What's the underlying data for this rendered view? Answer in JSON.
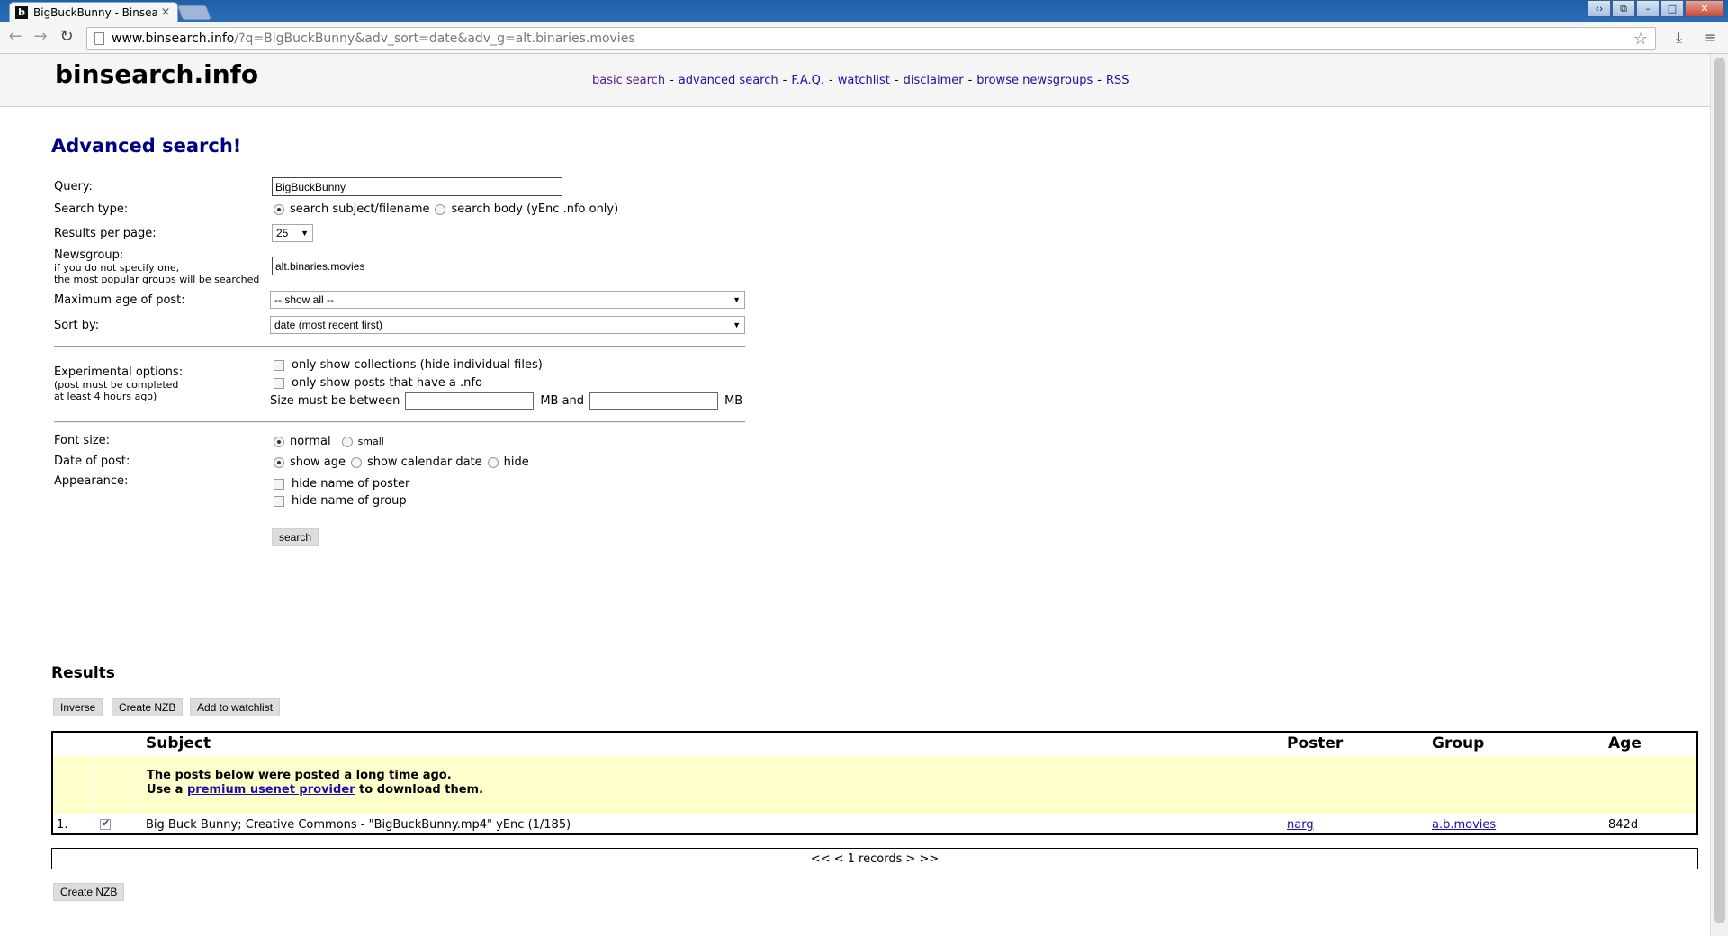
{
  "browser": {
    "tab_title": "BigBuckBunny - Binsearch",
    "favicon_letter": "b",
    "url_domain": "www.binsearch.info",
    "url_rest": "/?q=BigBuckBunny&adv_sort=date&adv_g=alt.binaries.movies"
  },
  "site": {
    "logo": "binsearch.info",
    "nav": [
      "basic search",
      "advanced search",
      "F.A.Q.",
      "watchlist",
      "disclaimer",
      "browse newsgroups",
      "RSS"
    ],
    "nav_separator": "-"
  },
  "form": {
    "title": "Advanced search!",
    "query_label": "Query:",
    "query_value": "BigBuckBunny",
    "search_type_label": "Search type:",
    "search_type_options": [
      "search subject/filename",
      "search body (yEnc .nfo only)"
    ],
    "results_per_page_label": "Results per page:",
    "results_per_page_value": "25",
    "newsgroup_label": "Newsgroup:",
    "newsgroup_hint_1": "if you do not specify one,",
    "newsgroup_hint_2": "the most popular groups will be searched",
    "newsgroup_value": "alt.binaries.movies",
    "max_age_label": "Maximum age of post:",
    "max_age_value": "-- show all --",
    "sort_label": "Sort by:",
    "sort_value": "date (most recent first)",
    "experimental_label": "Experimental options:",
    "experimental_hint_1": "(post must be completed",
    "experimental_hint_2": "at least 4 hours ago)",
    "opt_collections": "only show collections (hide individual files)",
    "opt_nfo": "only show posts that have a .nfo",
    "size_prefix": "Size must be between",
    "size_mid": "MB and",
    "size_suffix": "MB",
    "font_size_label": "Font size:",
    "font_size_options": [
      "normal",
      "small"
    ],
    "date_label": "Date of post:",
    "date_options": [
      "show age",
      "show calendar date",
      "hide"
    ],
    "appearance_label": "Appearance:",
    "opt_hide_poster": "hide name of poster",
    "opt_hide_group": "hide name of group",
    "search_button": "search"
  },
  "results": {
    "heading": "Results",
    "buttons": [
      "Inverse",
      "Create NZB",
      "Add to watchlist"
    ],
    "columns": [
      "Subject",
      "Poster",
      "Group",
      "Age"
    ],
    "notice_line1": "The posts below were posted a long time ago.",
    "notice_prefix": "Use a",
    "notice_link": "premium usenet provider",
    "notice_suffix": "to download them.",
    "rows": [
      {
        "num": "1.",
        "checked": true,
        "subject": "Big Buck Bunny; Creative Commons - \"BigBuckBunny.mp4\" yEnc (1/185)",
        "poster": "narg",
        "group": "a.b.movies",
        "age": "842d"
      }
    ],
    "pager": "<< < 1 records > >>",
    "bottom_button": "Create NZB"
  }
}
